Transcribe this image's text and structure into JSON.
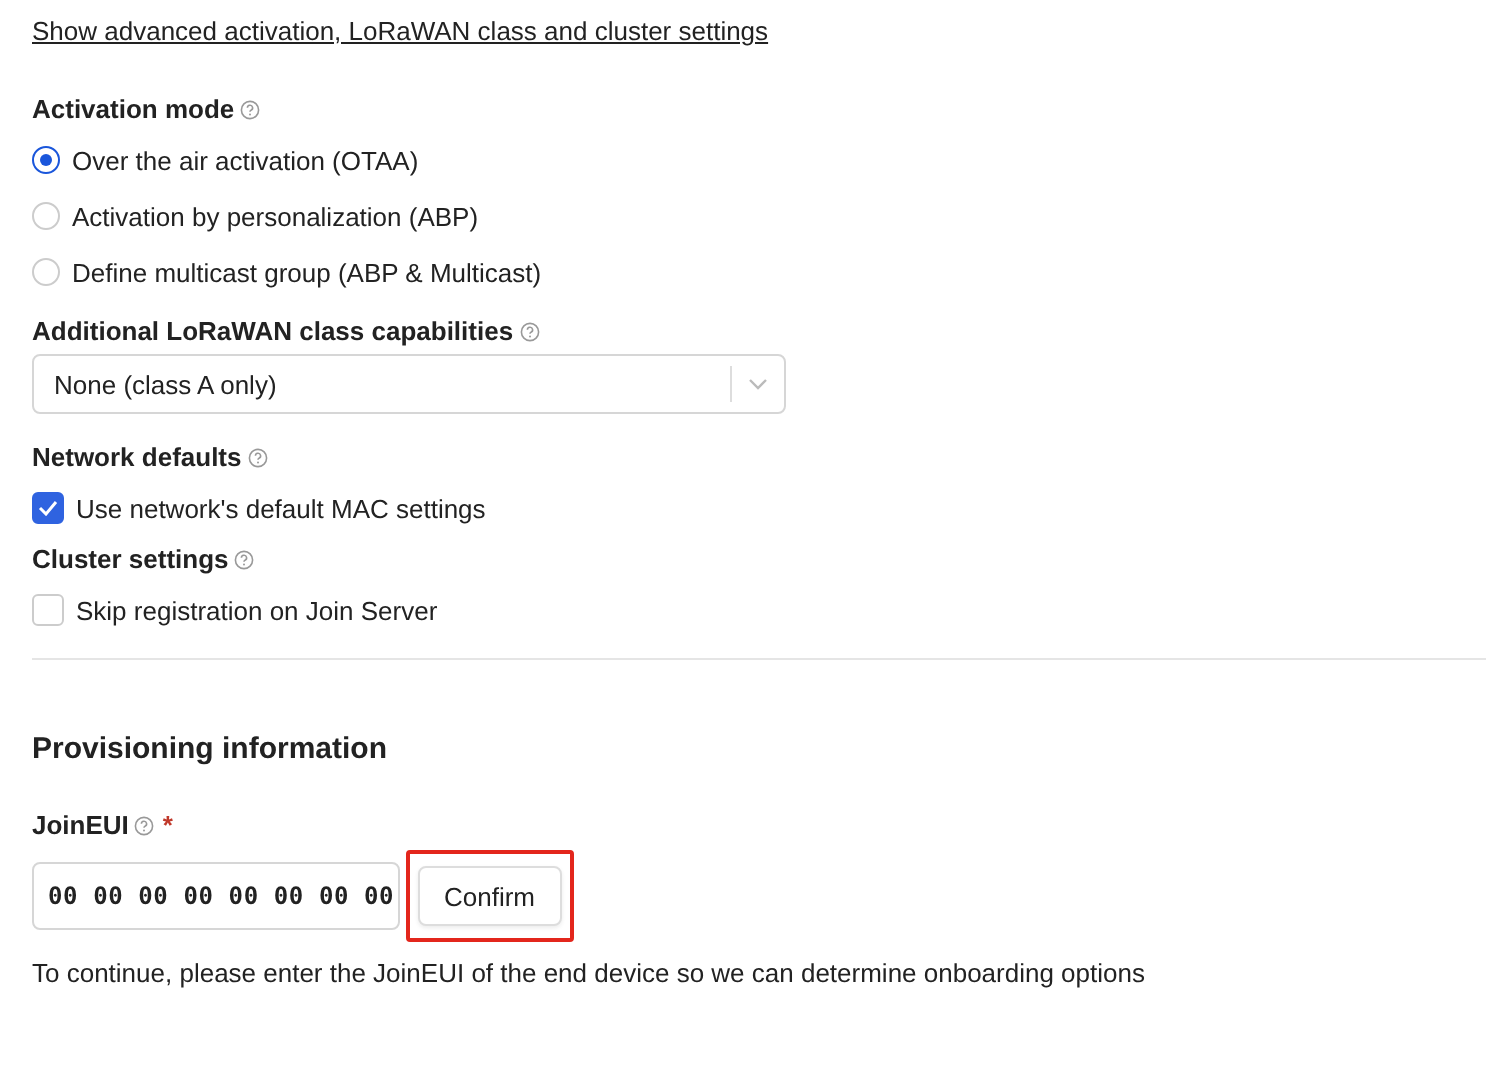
{
  "advanced_link": "Show advanced activation, LoRaWAN class and cluster settings",
  "activation_mode": {
    "label": "Activation mode",
    "options": [
      {
        "label": "Over the air activation (OTAA)",
        "selected": true
      },
      {
        "label": "Activation by personalization (ABP)",
        "selected": false
      },
      {
        "label": "Define multicast group (ABP & Multicast)",
        "selected": false
      }
    ]
  },
  "class_capabilities": {
    "label": "Additional LoRaWAN class capabilities",
    "value": "None (class A only)"
  },
  "network_defaults": {
    "label": "Network defaults",
    "checkbox": {
      "label": "Use network's default MAC settings",
      "checked": true
    }
  },
  "cluster_settings": {
    "label": "Cluster settings",
    "checkbox": {
      "label": "Skip registration on Join Server",
      "checked": false
    }
  },
  "provisioning": {
    "title": "Provisioning information",
    "join_eui": {
      "label": "JoinEUI",
      "required_mark": "*",
      "value": "00 00 00 00 00 00 00 00"
    },
    "confirm_button": {
      "label": "Confirm",
      "highlighted": true
    },
    "hint": "To continue, please enter the JoinEUI of the end device so we can determine onboarding options"
  }
}
